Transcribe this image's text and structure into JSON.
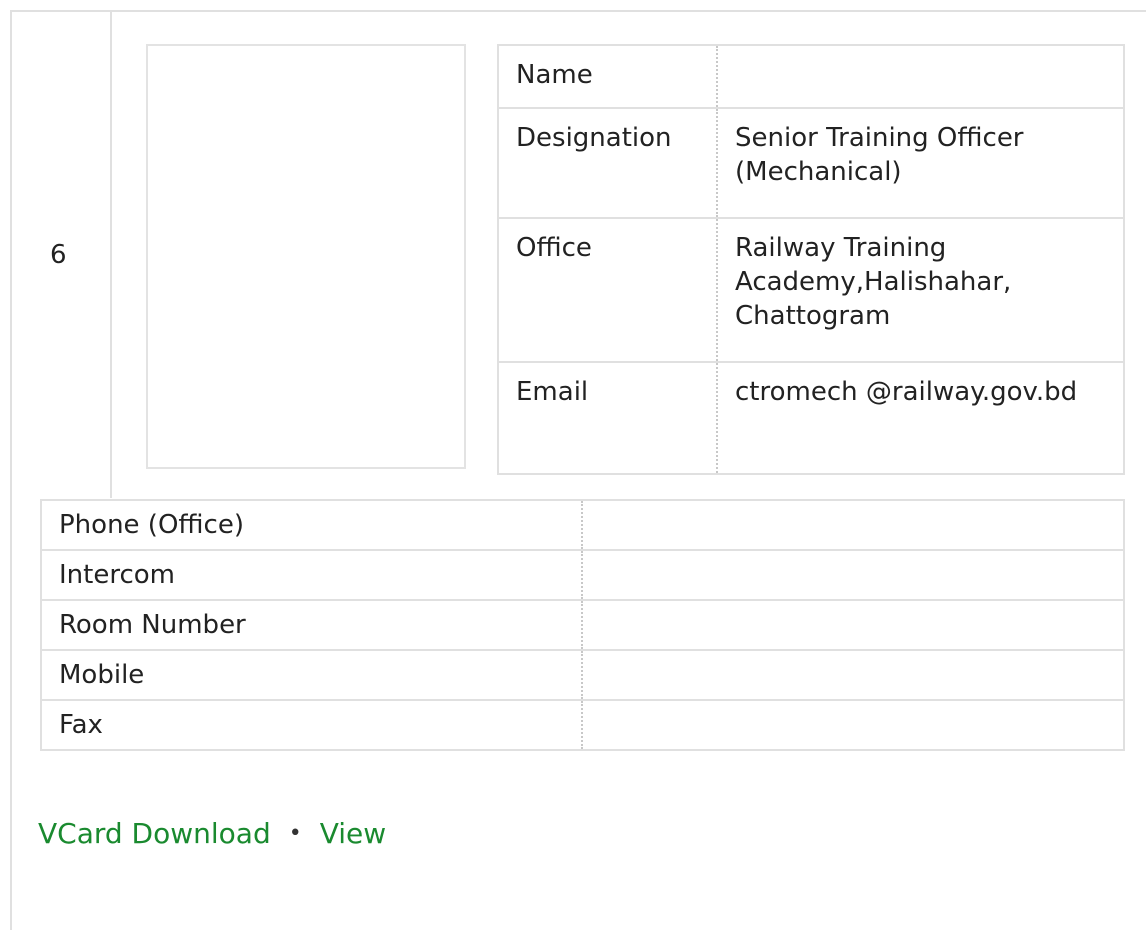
{
  "entry": {
    "serial": "6",
    "colors": {
      "link": "#1a8a2f",
      "border": "#e0e0e0"
    }
  },
  "info": [
    {
      "label": "Name",
      "value": ""
    },
    {
      "label": "Designation",
      "value": "Senior Training Officer (Mechanical)"
    },
    {
      "label": "Office",
      "value": "Railway Training Academy,Halishahar, Chattogram"
    },
    {
      "label": "Email",
      "value": "ctromech @railway.gov.bd"
    }
  ],
  "contact": [
    {
      "label": "Phone (Office)",
      "value": ""
    },
    {
      "label": "Intercom",
      "value": ""
    },
    {
      "label": "Room Number",
      "value": ""
    },
    {
      "label": "Mobile",
      "value": ""
    },
    {
      "label": "Fax",
      "value": ""
    }
  ],
  "links": {
    "vcard": "VCard Download",
    "separator": "•",
    "view": "View"
  }
}
